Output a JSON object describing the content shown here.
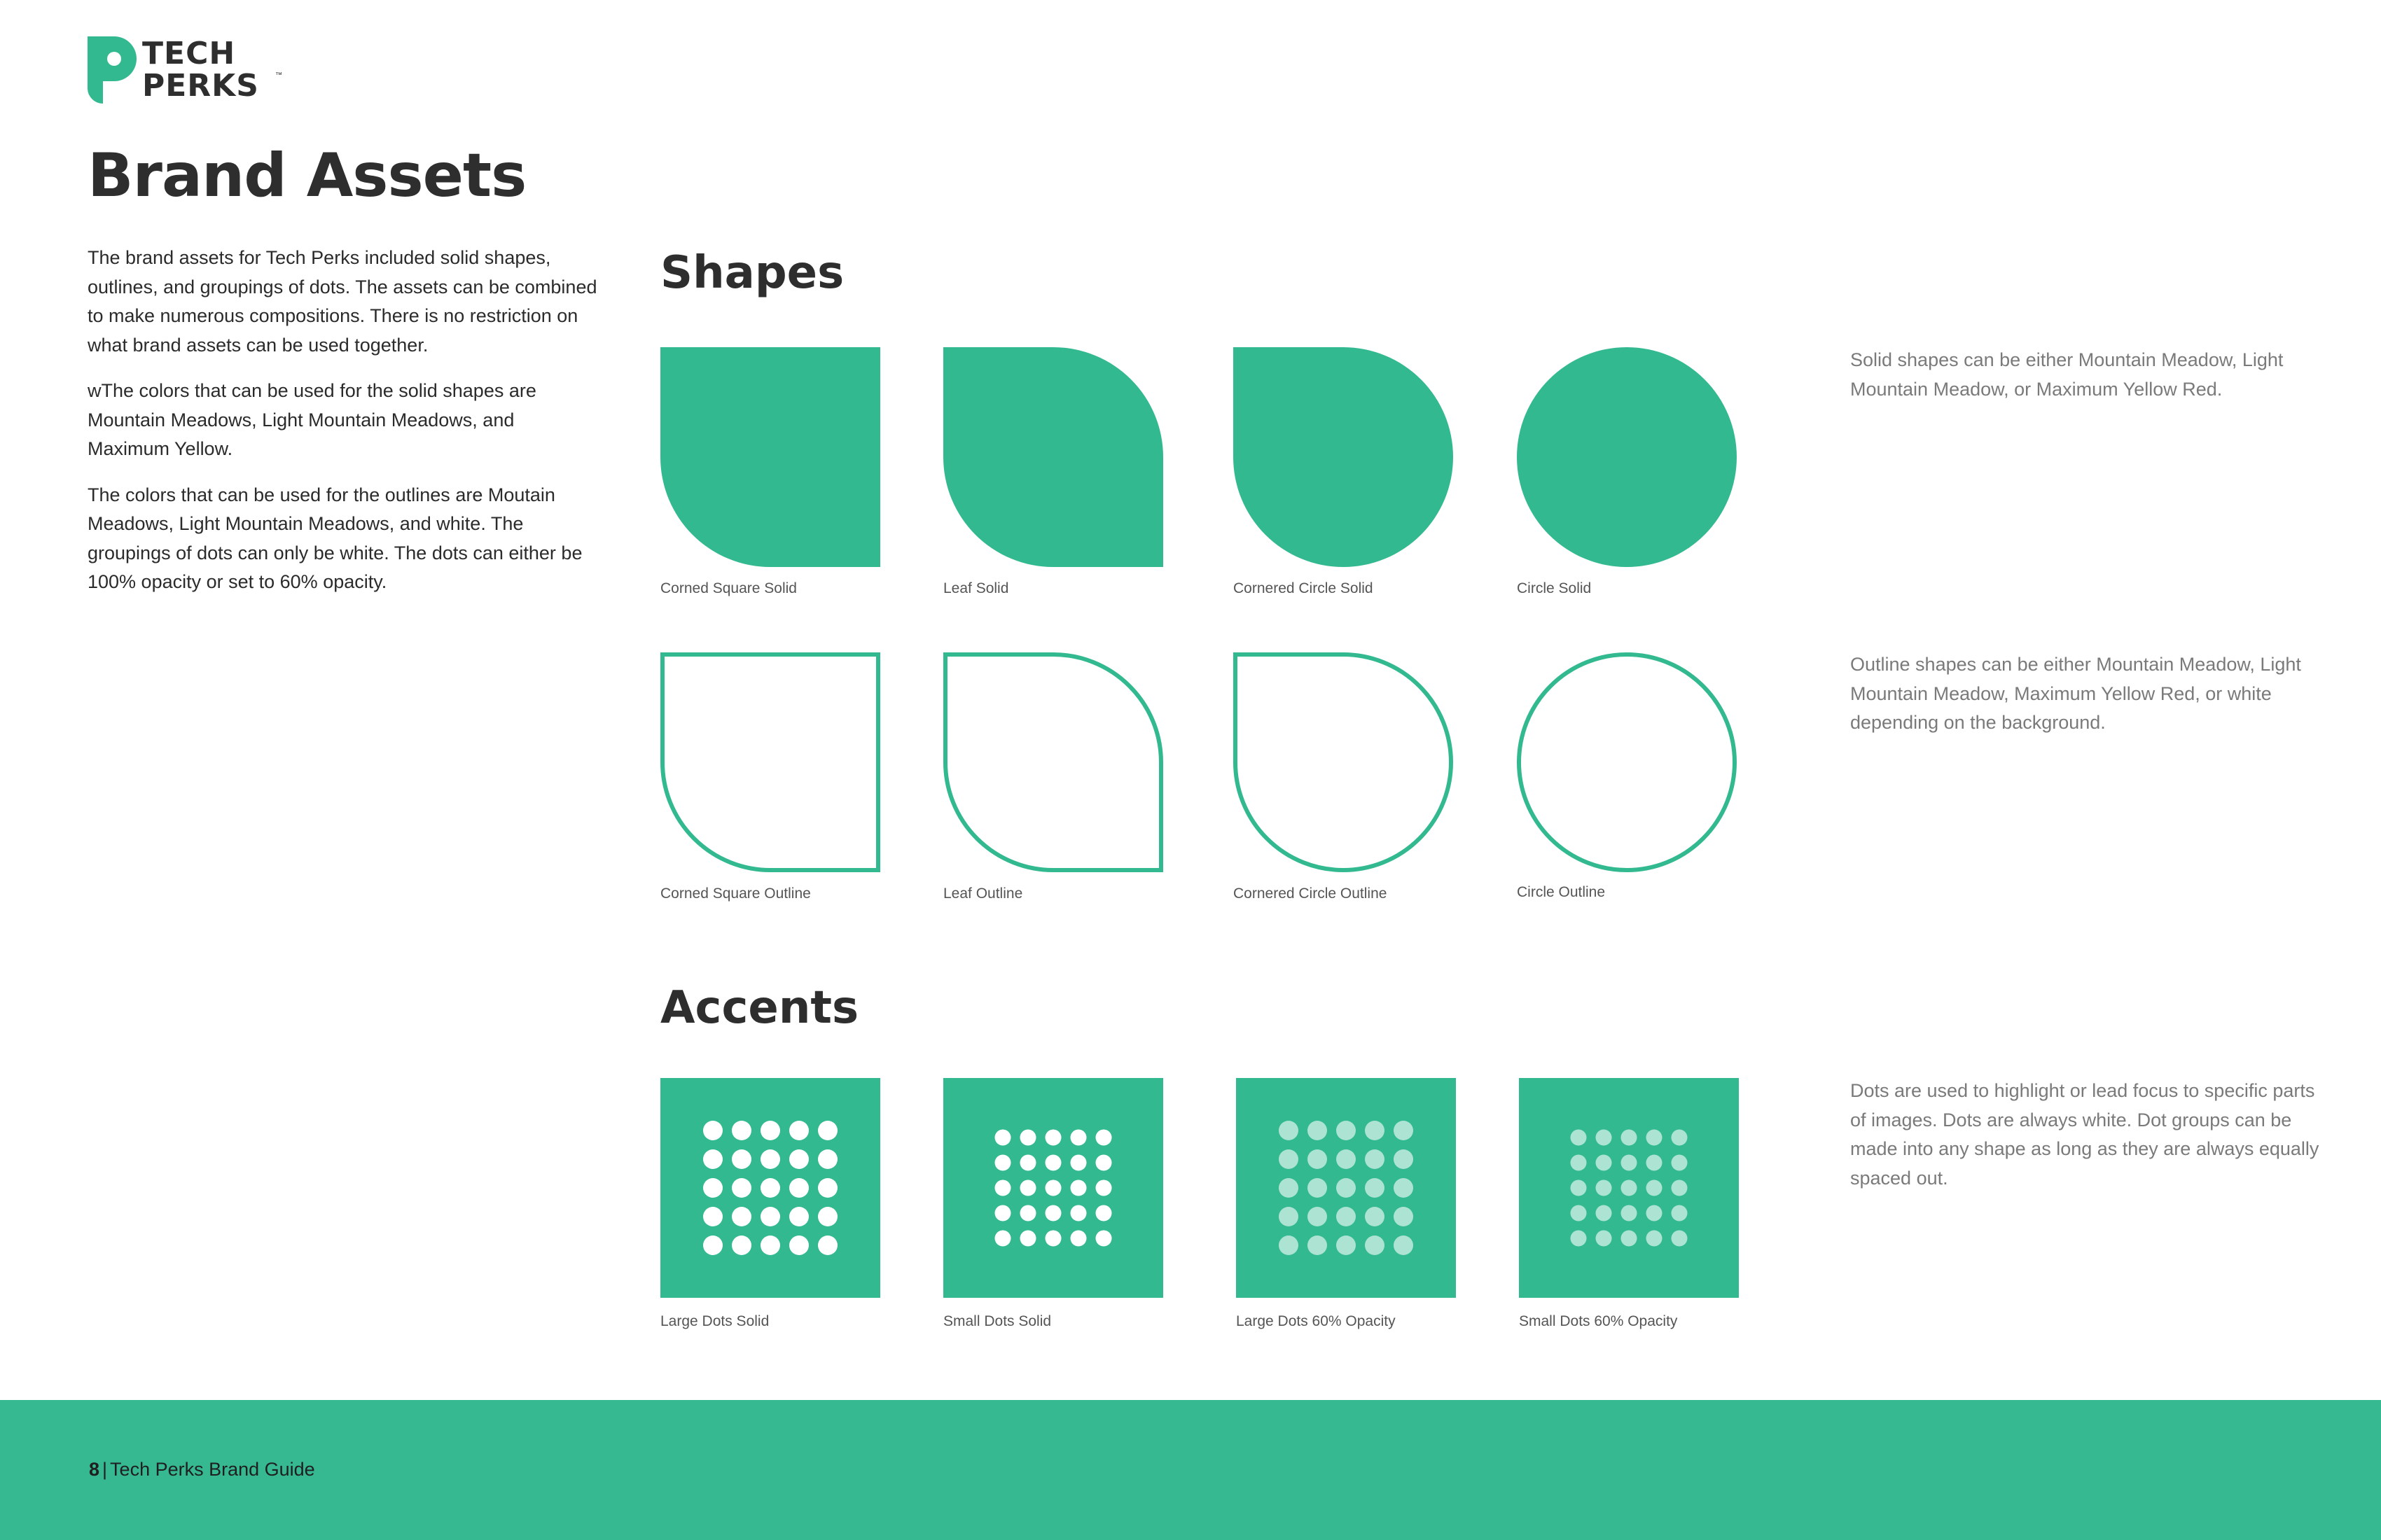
{
  "brand": {
    "logo_line1": "TECH",
    "logo_line2": "PERKS",
    "logo_tm": "™",
    "color_primary": "#33b98f",
    "color_text": "#2e2e2e"
  },
  "page": {
    "title": "Brand Assets",
    "intro": [
      "The brand assets for Tech Perks included solid shapes, outlines, and groupings of dots. The assets can be combined to make numerous compositions. There is no restriction on what brand assets can be used together.",
      "wThe colors that can be used for the solid shapes are Mountain Meadows, Light Mountain Meadows, and Maximum Yellow.",
      "The colors that can be used for the outlines are Moutain Meadows, Light Mountain Meadows, and white. The groupings of dots can only be white. The dots can either be 100% opacity or set to 60% opacity."
    ]
  },
  "shapes": {
    "heading": "Shapes",
    "solid": [
      {
        "label": "Corned Square Solid",
        "shape": "corned-square"
      },
      {
        "label": "Leaf Solid",
        "shape": "leaf"
      },
      {
        "label": "Cornered Circle Solid",
        "shape": "cornered-circle"
      },
      {
        "label": "Circle Solid",
        "shape": "circle"
      }
    ],
    "outline": [
      {
        "label": "Corned Square Outline",
        "shape": "corned-square"
      },
      {
        "label": "Leaf Outline",
        "shape": "leaf"
      },
      {
        "label": "Cornered Circle Outline",
        "shape": "cornered-circle"
      },
      {
        "label": "Circle Outline",
        "shape": "circle"
      }
    ],
    "solid_note": "Solid shapes can be either Mountain Meadow, Light Mountain Meadow, or Maximum Yellow Red.",
    "outline_note": "Outline shapes can be either Mountain Meadow, Light Mountain Meadow, Maximum Yellow Red, or white depending on the background."
  },
  "accents": {
    "heading": "Accents",
    "tiles": [
      {
        "label": "Large Dots Solid",
        "dot_size": "large",
        "opacity": 1.0
      },
      {
        "label": "Small Dots Solid",
        "dot_size": "small",
        "opacity": 1.0
      },
      {
        "label": "Large Dots 60% Opacity",
        "dot_size": "large",
        "opacity": 0.6
      },
      {
        "label": "Small Dots 60% Opacity",
        "dot_size": "small",
        "opacity": 0.6
      }
    ],
    "grid": "5x5",
    "note": "Dots are used to highlight or lead focus to specific parts of images. Dots are always white. Dot groups can be made into any shape as long as they are always equally spaced out."
  },
  "footer": {
    "page_number": "8",
    "separator": "|",
    "title": "Tech Perks Brand Guide"
  }
}
